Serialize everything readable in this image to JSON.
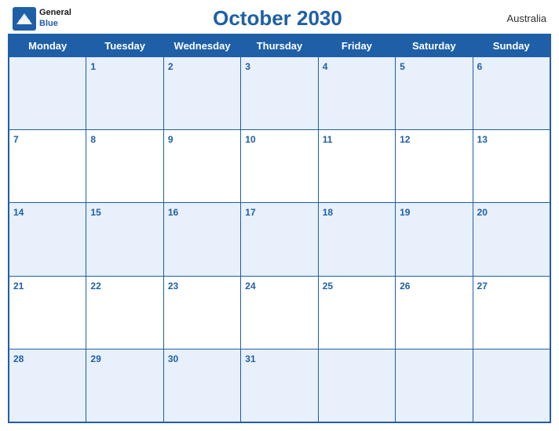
{
  "header": {
    "logo": {
      "general": "General",
      "blue": "Blue"
    },
    "title": "October 2030",
    "country": "Australia"
  },
  "days_of_week": [
    "Monday",
    "Tuesday",
    "Wednesday",
    "Thursday",
    "Friday",
    "Saturday",
    "Sunday"
  ],
  "weeks": [
    [
      "",
      "1",
      "2",
      "3",
      "4",
      "5",
      "6"
    ],
    [
      "7",
      "8",
      "9",
      "10",
      "11",
      "12",
      "13"
    ],
    [
      "14",
      "15",
      "16",
      "17",
      "18",
      "19",
      "20"
    ],
    [
      "21",
      "22",
      "23",
      "24",
      "25",
      "26",
      "27"
    ],
    [
      "28",
      "29",
      "30",
      "31",
      "",
      "",
      ""
    ]
  ]
}
